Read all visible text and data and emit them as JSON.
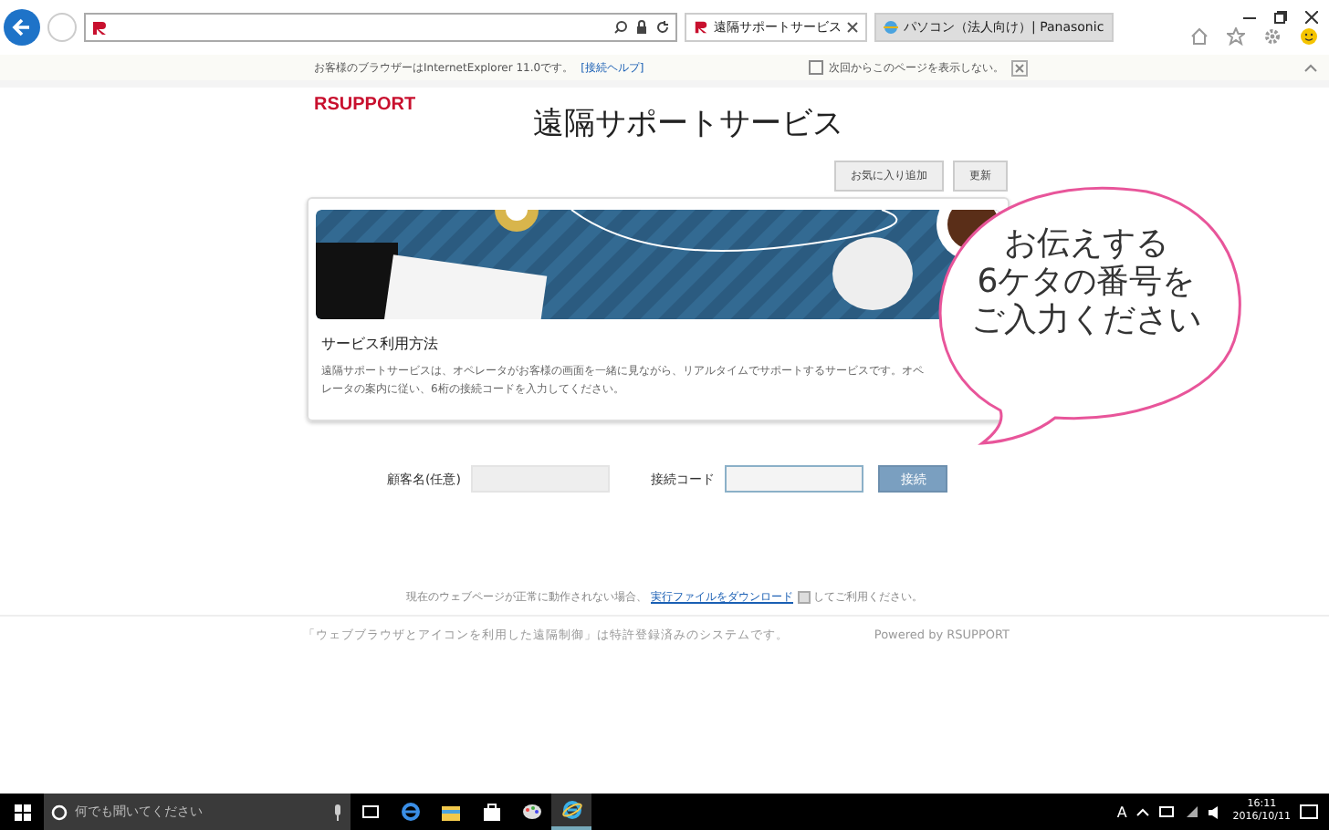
{
  "browser": {
    "tabs": [
      {
        "label": "遠隔サポートサービス",
        "selected": true
      },
      {
        "label": "パソコン（法人向け）| Panasonic",
        "selected": false
      }
    ],
    "info_bar": {
      "message": "お客様のブラウザーはInternetExplorer 11.0です。",
      "help_link": "[接続ヘルプ]",
      "dont_show": {
        "label": "次回からこのページを表示しない。",
        "checked": false
      }
    }
  },
  "page": {
    "logo": "RSUPPORT",
    "title": "遠隔サポートサービス",
    "buttons": [
      "お気に入り追加",
      "更新"
    ],
    "card": {
      "heading": "サービス利用方法",
      "description": "遠隔サポートサービスは、オペレータがお客様の画面を一緒に見ながら、リアルタイムでサポートするサービスです。オペレータの案内に従い、6桁の接続コードを入力してください。"
    },
    "form": {
      "fields": [
        {
          "label": "顧客名(任意)",
          "focused": false
        },
        {
          "label": "接続コード",
          "focused": true
        }
      ],
      "submit": "接続"
    },
    "note": {
      "before": "現在のウェブページが正常に動作されない場合、",
      "link": "実行ファイルをダウンロード",
      "after": "してご利用ください。"
    },
    "footer": {
      "patent": "「ウェブブラウザとアイコンを利用した遠隔制御」は特許登録済みのシステムです。",
      "powered": "Powered by RSUPPORT"
    }
  },
  "callout": {
    "lines": [
      "お伝えする",
      "6ケタの番号を",
      "ご入力ください"
    ]
  },
  "taskbar": {
    "search_placeholder": "何でも聞いてください",
    "apps": [
      {
        "kind": "taskview",
        "selected": false
      },
      {
        "kind": "edge",
        "selected": false
      },
      {
        "kind": "folder",
        "selected": false
      },
      {
        "kind": "store",
        "selected": false
      },
      {
        "kind": "paint",
        "selected": false
      },
      {
        "kind": "ie",
        "selected": true
      }
    ],
    "ime": "A",
    "time": "16:11",
    "date": "2016/10/11"
  }
}
